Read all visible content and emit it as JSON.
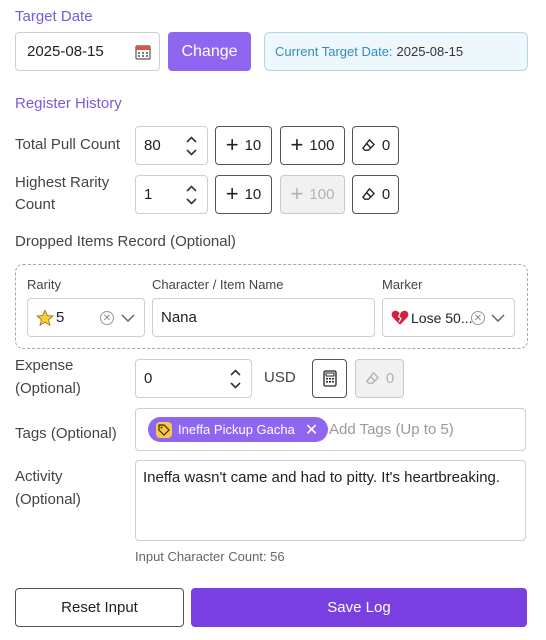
{
  "target_date": {
    "title": "Target Date",
    "input_value": "2025-08-15",
    "change_label": "Change",
    "current_label": "Current Target Date:",
    "current_value": "2025-08-15"
  },
  "register": {
    "title": "Register History",
    "total_pull": {
      "label": "Total Pull Count",
      "value": "80",
      "plus10": "10",
      "plus100": "100",
      "reset": "0"
    },
    "highest_rarity": {
      "label_line1": "Highest Rarity",
      "label_line2": "Count",
      "value": "1",
      "plus10": "10",
      "plus100": "100",
      "reset": "0"
    },
    "dropped": {
      "label": "Dropped Items Record (Optional)",
      "rarity_header": "Rarity",
      "name_header": "Character / Item Name",
      "marker_header": "Marker",
      "rarity_value": "5",
      "name_value": "Nana",
      "marker_value": "Lose 50..."
    },
    "expense": {
      "label_line1": "Expense",
      "label_line2": "(Optional)",
      "value": "0",
      "currency": "USD",
      "reset": "0"
    },
    "tags": {
      "label": "Tags (Optional)",
      "chip": "Ineffa Pickup Gacha",
      "placeholder": "Add Tags (Up to 5)"
    },
    "activity": {
      "label_line1": "Activity",
      "label_line2": "(Optional)",
      "value": "Ineffa wasn't came and had to pitty. It's heartbreaking.",
      "char_count": "Input Character Count: 56"
    }
  },
  "actions": {
    "reset": "Reset Input",
    "save": "Save Log"
  },
  "colors": {
    "accent": "#8e66f0",
    "save": "#7a3fe0",
    "section_title": "#7b59d9"
  }
}
